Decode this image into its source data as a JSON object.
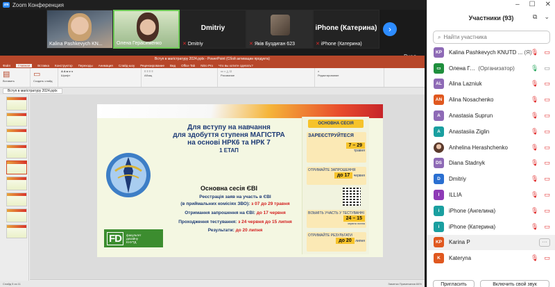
{
  "window": {
    "title": "Zoom Конференция",
    "logo": "zm"
  },
  "videos": [
    {
      "name": "Kalina Pashkevych KN...",
      "muted": false
    },
    {
      "name": "Олена Герасименко",
      "muted": false
    },
    {
      "name": "Dmitriy",
      "label": "Dmitriy",
      "muted": true
    },
    {
      "name": "Яків Буздиган 623",
      "muted": true
    },
    {
      "name": "iPhone (Катерина)",
      "label": "iPhone (Катерина)",
      "muted": true
    }
  ],
  "vhod": "Вход",
  "ppt": {
    "window_title": "Вступ в магістратуру 2024.pptx - PowerPoint (Сбой активации продукта)",
    "tabs": [
      "Файл",
      "Главная",
      "Вставка",
      "Конструктор",
      "Переходы",
      "Анимация",
      "Слайд-шоу",
      "Рецензирование",
      "Вид",
      "Office Tab",
      "Nitro Pro",
      "Что вы хотите сделать?"
    ],
    "ribbon": [
      "Вставить",
      "Создать слайд",
      "Шрифт",
      "Абзац",
      "Рисование",
      "Редактирование"
    ],
    "doc_tab": "Вступ в магістратуру 2024.pptx",
    "slide_count": 9,
    "active_slide": 5,
    "notes": "Заметки к слайду",
    "status_left": "Слайд 5 из 11",
    "status_right": "Заметки  Примечания  84%"
  },
  "slide": {
    "heading_lines": [
      "Для вступу на навчання",
      "для здобуття ступеня МАГІСТРА",
      "на основі НРК6 та НРК 7"
    ],
    "etap": "1 ЕТАП",
    "session_title": "Основна сесія ЄВІ",
    "info": [
      {
        "text": "Реєстрація заяв на участь в ЄВІ",
        "red": ""
      },
      {
        "text": "(в приймальних комісіях ЗВО):",
        "red": " з 07 до 29 травня"
      },
      {
        "text": "Отримання запрошення на ЄВІ:",
        "red": " до 17 червня"
      },
      {
        "text": "Проходження тестування:",
        "red": " з 24 червня до 15 липня"
      },
      {
        "text": "Результати:",
        "red": " до 20 липня"
      }
    ],
    "fd": {
      "mark": "FD",
      "line1": "факультет",
      "line2": "дизайну",
      "line3": "КНУТД"
    },
    "panel_head": "ОСНОВНА СЕСІЯ",
    "register": {
      "title": "ЗАРЕЄСТРУЙТЕСЯ",
      "date": "7 – 29",
      "month": "травня"
    },
    "invite": {
      "title": "ОТРИМАЙТЕ ЗАПРОШЕННЯ",
      "date": "до 17",
      "month": "червня"
    },
    "test": {
      "title": "ВІЗЬМІТЬ УЧАСТЬ У ТЕСТУВАННІ",
      "date": "24 – 15",
      "month": "червня  липня"
    },
    "results": {
      "title": "ОТРИМАЙТЕ РЕЗУЛЬТАТИ",
      "date": "до 20",
      "month": "липня"
    }
  },
  "participants": {
    "title": "Участники (93)",
    "search_placeholder": "Найти участника",
    "list": [
      {
        "initials": "KP",
        "color": "#8e6ab6",
        "name": "Kalina Pashkevych KNUTD ...",
        "suffix": "(Я)",
        "mic": "off",
        "cam": "off"
      },
      {
        "initials": "",
        "color": "#1f8f3d",
        "name": "Олена Гер...",
        "suffix": "(Организатор)",
        "mic": "on",
        "cam": "on"
      },
      {
        "initials": "AL",
        "color": "#8e6ab6",
        "name": "Alina Lazniuk",
        "suffix": "",
        "mic": "off",
        "cam": "off"
      },
      {
        "initials": "AN",
        "color": "#e0581f",
        "name": "Alina Nosachenko",
        "suffix": "",
        "mic": "off",
        "cam": "off"
      },
      {
        "initials": "A",
        "color": "#8e6ab6",
        "name": "Anastasia Suprun",
        "suffix": "",
        "mic": "off",
        "cam": "off"
      },
      {
        "initials": "A",
        "color": "#1a9fa0",
        "name": "Anastasiia Ziglin",
        "suffix": "",
        "mic": "off",
        "cam": "off"
      },
      {
        "initials": "",
        "color": "photo",
        "name": "Anhelina Herashchenko",
        "suffix": "",
        "mic": "off",
        "cam": "off"
      },
      {
        "initials": "DS",
        "color": "#8e6ab6",
        "name": "Diana Stadnyk",
        "suffix": "",
        "mic": "off",
        "cam": "off"
      },
      {
        "initials": "D",
        "color": "#2a6fd1",
        "name": "Dmitriy",
        "suffix": "",
        "mic": "off",
        "cam": "off"
      },
      {
        "initials": "I",
        "color": "#8e3ab6",
        "name": "ILLIA",
        "suffix": "",
        "mic": "off",
        "cam": "off"
      },
      {
        "initials": "i",
        "color": "#1a9fa0",
        "name": "iPhone (Ангелина)",
        "suffix": "",
        "mic": "off",
        "cam": "off"
      },
      {
        "initials": "i",
        "color": "#1a9fa0",
        "name": "iPhone (Катерина)",
        "suffix": "",
        "mic": "off",
        "cam": "off"
      },
      {
        "initials": "KP",
        "color": "#e0581f",
        "name": "Karina P",
        "suffix": "",
        "mic": "more",
        "cam": ""
      },
      {
        "initials": "K",
        "color": "#e0581f",
        "name": "Kateryna",
        "suffix": "",
        "mic": "off",
        "cam": "off"
      }
    ],
    "invite_button": "Пригласить",
    "unmute_button": "Включить свой звук"
  }
}
